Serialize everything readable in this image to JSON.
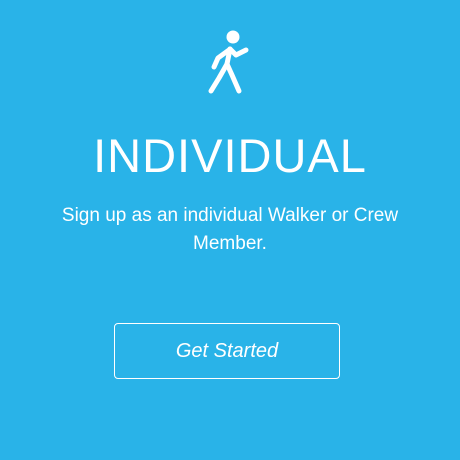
{
  "card": {
    "icon": "walker-icon",
    "title": "INDIVIDUAL",
    "subtitle": "Sign up as an individual Walker or Crew Member.",
    "button_label": "Get Started",
    "background_color": "#29b3e8",
    "text_color": "#ffffff"
  }
}
